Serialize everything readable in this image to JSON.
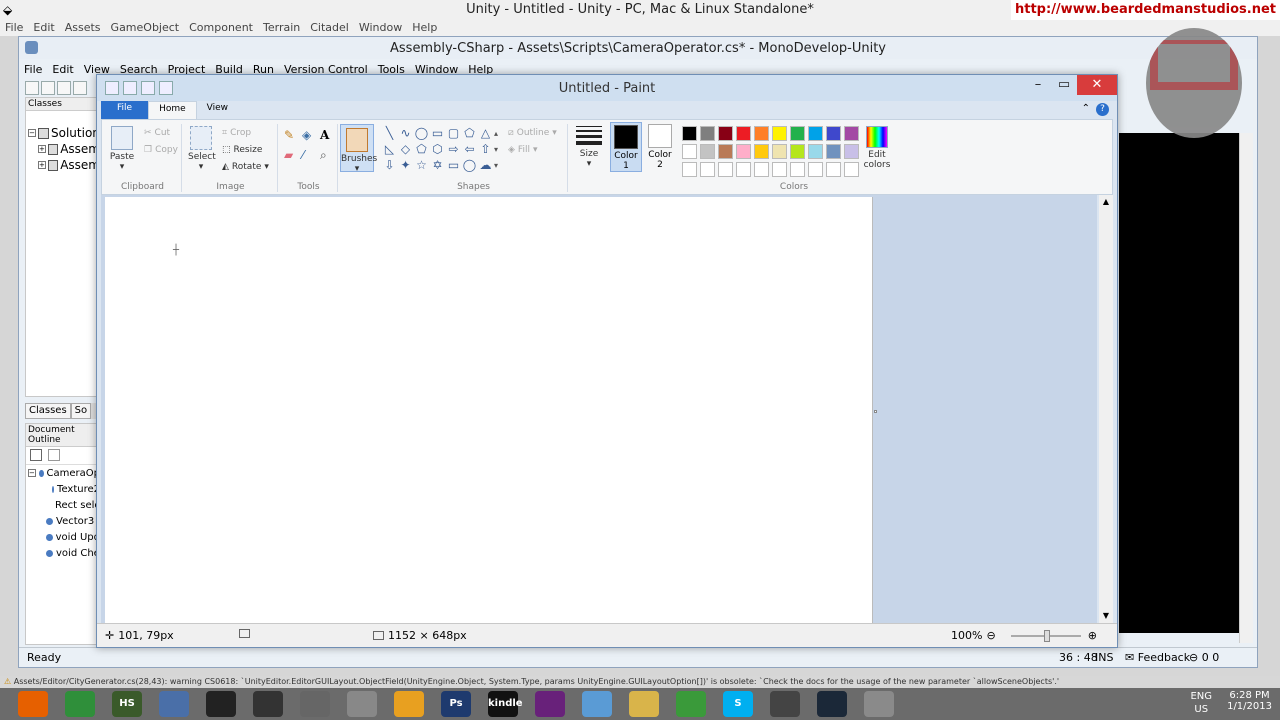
{
  "unity": {
    "title": "Unity - Untitled - Unity - PC, Mac & Linux Standalone*",
    "watermark": "http://www.beardedmanstudios.net",
    "menu": [
      "File",
      "Edit",
      "Assets",
      "GameObject",
      "Component",
      "Terrain",
      "Citadel",
      "Window",
      "Help"
    ]
  },
  "monodevelop": {
    "title": "Assembly-CSharp - Assets\\Scripts\\CameraOperator.cs* - MonoDevelop-Unity",
    "menu": [
      "File",
      "Edit",
      "View",
      "Search",
      "Project",
      "Build",
      "Run",
      "Version Control",
      "Tools",
      "Window",
      "Help"
    ],
    "classes_label": "Classes",
    "tree": [
      "Solution",
      "Assem",
      "Assem"
    ],
    "tabs": [
      "Classes",
      "So"
    ],
    "outline_label": "Document Outline",
    "outline_items": [
      "CameraOp",
      "Texture2",
      "Rect sele",
      "Vector3",
      "void Upd",
      "void Che"
    ],
    "status_left": "Ready",
    "status_pos": "36 : 48",
    "status_mode": "INS",
    "feedback": "Feedback",
    "counts": "0  0"
  },
  "paint": {
    "title": "Untitled - Paint",
    "tabs": {
      "file": "File",
      "home": "Home",
      "view": "View"
    },
    "clipboard": {
      "paste": "Paste",
      "cut": "Cut",
      "copy": "Copy",
      "label": "Clipboard"
    },
    "image": {
      "select": "Select",
      "crop": "Crop",
      "resize": "Resize",
      "rotate": "Rotate",
      "label": "Image"
    },
    "tools": {
      "label": "Tools"
    },
    "brushes": "Brushes",
    "shapes": {
      "outline": "Outline",
      "fill": "Fill",
      "label": "Shapes"
    },
    "size": "Size",
    "color1": {
      "label": "Color",
      "num": "1",
      "value": "#000000"
    },
    "color2": {
      "label": "Color",
      "num": "2",
      "value": "#ffffff"
    },
    "colors_label": "Colors",
    "edit_colors": [
      "Edit",
      "colors"
    ],
    "palette": [
      "#000000",
      "#7f7f7f",
      "#880015",
      "#ed1c24",
      "#ff7f27",
      "#fff200",
      "#22b14c",
      "#00a2e8",
      "#3f48cc",
      "#a349a4",
      "#ffffff",
      "#c3c3c3",
      "#b97a57",
      "#ffaec9",
      "#ffc90e",
      "#efe4b0",
      "#b5e61d",
      "#99d9ea",
      "#7092be",
      "#c8bfe7",
      "#ffffff",
      "#ffffff",
      "#ffffff",
      "#ffffff",
      "#ffffff",
      "#ffffff",
      "#ffffff",
      "#ffffff",
      "#ffffff",
      "#ffffff"
    ],
    "status": {
      "cursor": "101, 79px",
      "canvas_size": "1152 × 648px",
      "zoom": "100%"
    }
  },
  "warning": "Assets/Editor/CityGenerator.cs(28,43): warning CS0618: `UnityEditor.EditorGUILayout.ObjectField(UnityEngine.Object, System.Type, params UnityEngine.GUILayoutOption[])' is obsolete: `Check the docs for the usage of the new parameter `allowSceneObjects'.'",
  "taskbar": {
    "icons": [
      {
        "name": "firefox",
        "color": "#e66000",
        "label": ""
      },
      {
        "name": "sheets",
        "color": "#2f8f3a",
        "label": ""
      },
      {
        "name": "hs",
        "color": "#3a5a2a",
        "label": "HS"
      },
      {
        "name": "app4",
        "color": "#4a6fa8",
        "label": ""
      },
      {
        "name": "unity",
        "color": "#222",
        "label": ""
      },
      {
        "name": "unity2",
        "color": "#333",
        "label": ""
      },
      {
        "name": "app7",
        "color": "#666",
        "label": ""
      },
      {
        "name": "calc",
        "color": "#888",
        "label": ""
      },
      {
        "name": "media",
        "color": "#e8a020",
        "label": ""
      },
      {
        "name": "photoshop",
        "color": "#1e3a6e",
        "label": "Ps"
      },
      {
        "name": "kindle",
        "color": "#111",
        "label": "kindle"
      },
      {
        "name": "vs",
        "color": "#68217a",
        "label": ""
      },
      {
        "name": "app13",
        "color": "#5a9bd5",
        "label": ""
      },
      {
        "name": "folder",
        "color": "#d9b44a",
        "label": ""
      },
      {
        "name": "chrome",
        "color": "#3a9a3a",
        "label": ""
      },
      {
        "name": "skype",
        "color": "#00aff0",
        "label": "S"
      },
      {
        "name": "app17",
        "color": "#444",
        "label": ""
      },
      {
        "name": "steam",
        "color": "#1b2838",
        "label": ""
      },
      {
        "name": "paint",
        "color": "#8a8a8a",
        "label": ""
      }
    ],
    "lang": [
      "ENG",
      "US"
    ],
    "time": "6:28 PM",
    "date": "1/1/2013"
  }
}
